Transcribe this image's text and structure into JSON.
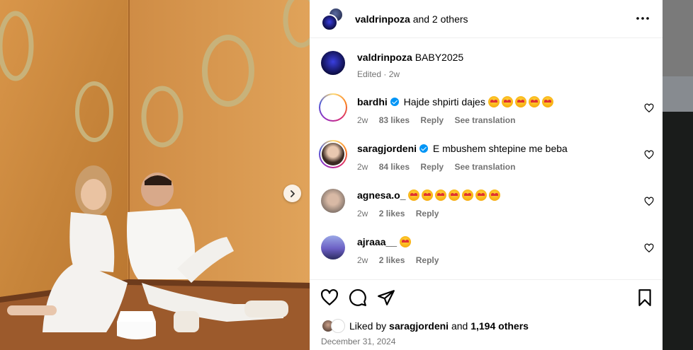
{
  "header": {
    "username": "valdrinpoza",
    "others_text": "and 2 others"
  },
  "caption": {
    "username": "valdrinpoza",
    "text": "BABY2025",
    "meta": "Edited · 2w"
  },
  "comments": [
    {
      "username": "bardhi",
      "verified": true,
      "text": "Hajde shpirti dajes",
      "emoji_count": 5,
      "time": "2w",
      "likes": "83 likes",
      "reply": "Reply",
      "translate": "See translation"
    },
    {
      "username": "saragjordeni",
      "verified": true,
      "text": "E mbushem shtepine me beba",
      "emoji_count": 0,
      "time": "2w",
      "likes": "84 likes",
      "reply": "Reply",
      "translate": "See translation"
    },
    {
      "username": "agnesa.o_",
      "verified": false,
      "text": "",
      "emoji_count": 7,
      "time": "2w",
      "likes": "2 likes",
      "reply": "Reply",
      "translate": ""
    },
    {
      "username": "ajraaa__",
      "verified": false,
      "text": "",
      "emoji_count": 1,
      "time": "2w",
      "likes": "2 likes",
      "reply": "Reply",
      "translate": ""
    }
  ],
  "likes": {
    "prefix": "Liked by",
    "first_user": "saragjordeni",
    "and": "and",
    "others": "1,194 others"
  },
  "post_date": "December 31, 2024",
  "icons": [
    "more-icon",
    "heart-icon",
    "comment-icon",
    "share-icon",
    "save-icon",
    "chevron-right-icon",
    "verified-icon"
  ],
  "colors": {
    "verified": "#0095f6",
    "meta_text": "#737373",
    "divider": "#efefef"
  }
}
